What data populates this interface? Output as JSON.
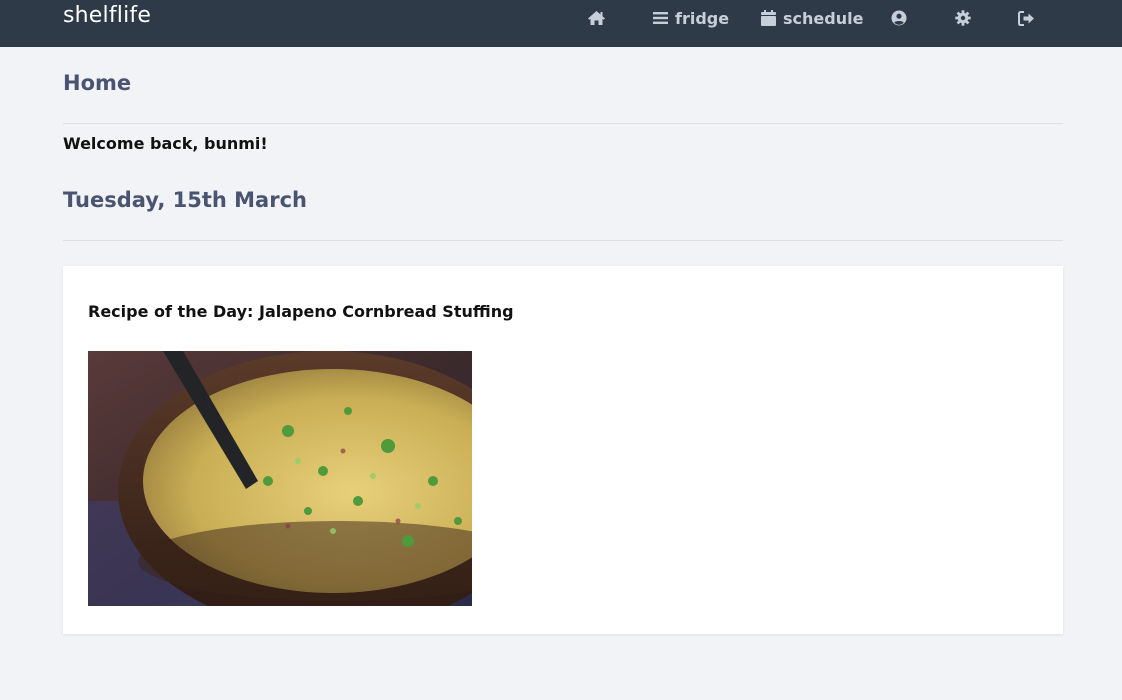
{
  "app": {
    "brand": "shelflife"
  },
  "nav": {
    "home_icon": "home-icon",
    "fridge_label": "fridge",
    "schedule_label": "schedule",
    "profile_icon": "user-circle-icon",
    "settings_icon": "gear-icon",
    "logout_icon": "sign-out-icon"
  },
  "page": {
    "title": "Home",
    "welcome": "Welcome back, bunmi!",
    "date": "Tuesday, 15th March"
  },
  "recipe": {
    "heading": "Recipe of the Day: Jalapeno Cornbread Stuffing",
    "image_alt": "Jalapeno Cornbread Stuffing"
  },
  "colors": {
    "navbar": "#2f3a48",
    "background": "#f2f3f6",
    "heading": "#4a5470",
    "nav_text": "#c7ced8"
  }
}
